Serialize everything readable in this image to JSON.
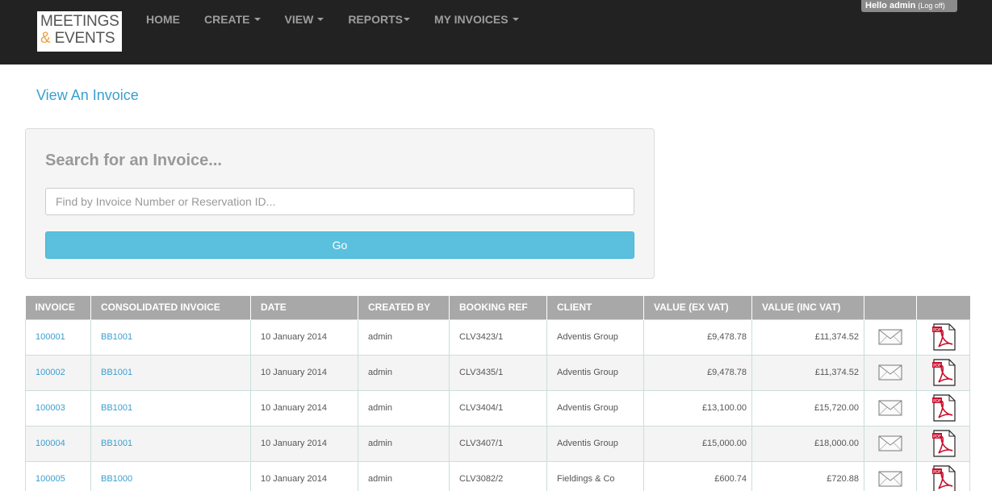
{
  "logo": {
    "line1": "MEETINGS",
    "amp": "&",
    "line2": " EVENTS"
  },
  "nav": {
    "home": "HOME",
    "create": "CREATE",
    "view": "VIEW",
    "reports": "REPORTS",
    "my_invoices": "MY INVOICES"
  },
  "user": {
    "hello": "Hello admin",
    "logoff": "(Log off)"
  },
  "page": {
    "title": "View An Invoice"
  },
  "search": {
    "heading": "Search for an Invoice...",
    "placeholder": "Find by Invoice Number or Reservation ID...",
    "value": "",
    "go_label": "Go"
  },
  "table": {
    "headers": [
      "INVOICE",
      "CONSOLIDATED INVOICE",
      "DATE",
      "CREATED BY",
      "BOOKING REF",
      "CLIENT",
      "VALUE (EX VAT)",
      "VALUE (INC VAT)",
      "",
      ""
    ],
    "rows": [
      {
        "invoice": "100001",
        "consolidated": "BB1001",
        "date": "10 January 2014",
        "created_by": "admin",
        "booking_ref": "CLV3423/1",
        "client": "Adventis Group",
        "ex_vat": "£9,478.78",
        "inc_vat": "£11,374.52"
      },
      {
        "invoice": "100002",
        "consolidated": "BB1001",
        "date": "10 January 2014",
        "created_by": "admin",
        "booking_ref": "CLV3435/1",
        "client": "Adventis Group",
        "ex_vat": "£9,478.78",
        "inc_vat": "£11,374.52"
      },
      {
        "invoice": "100003",
        "consolidated": "BB1001",
        "date": "10 January 2014",
        "created_by": "admin",
        "booking_ref": "CLV3404/1",
        "client": "Adventis Group",
        "ex_vat": "£13,100.00",
        "inc_vat": "£15,720.00"
      },
      {
        "invoice": "100004",
        "consolidated": "BB1001",
        "date": "10 January 2014",
        "created_by": "admin",
        "booking_ref": "CLV3407/1",
        "client": "Adventis Group",
        "ex_vat": "£15,000.00",
        "inc_vat": "£18,000.00"
      },
      {
        "invoice": "100005",
        "consolidated": "BB1000",
        "date": "10 January 2014",
        "created_by": "admin",
        "booking_ref": "CLV3082/2",
        "client": "Fieldings & Co",
        "ex_vat": "£600.74",
        "inc_vat": "£720.88"
      }
    ],
    "icons": {
      "email": "envelope-icon",
      "pdf": "pdf-document-icon"
    }
  },
  "colors": {
    "topbar": "#222222",
    "nav_text": "#9d9d9d",
    "accent_link": "#3a9fd0",
    "go_button": "#5bc0de",
    "table_header": "#a8a8a8",
    "logo_amp": "#e8a33d"
  }
}
